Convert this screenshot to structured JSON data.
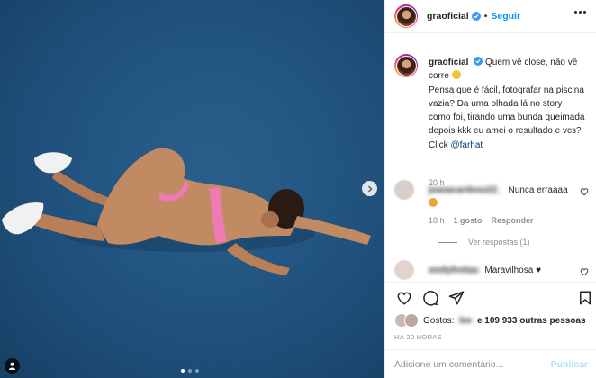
{
  "post": {
    "username": "graoficial",
    "follow_label": "Seguir",
    "caption_username": "graoficial",
    "caption_line1": "Quem vê close, não vê corre",
    "caption_line2": "Pensa que é fácil, fotografar na piscina vazia? Da uma olhada lá no story como foi, tirando uma bunda queimada depois kkk eu amei o resultado e vcs?",
    "caption_click": "Click",
    "caption_mention": "@farhat",
    "caption_time": "20 h"
  },
  "comments": [
    {
      "username": "joanacardoso22_",
      "text": "Nunca erraaaa",
      "time": "18 h",
      "likes": "1 gosto",
      "reply_label": "Responder",
      "view_replies": "Ver respostas (1)"
    },
    {
      "username": "emilyfreitas",
      "text": "Maravilhosa ♥"
    }
  ],
  "likes": {
    "prefix": "Gostos:",
    "blurred_name": "lee",
    "rest": "e 109 933 outras pessoas"
  },
  "post_time": "HÁ 20 HORAS",
  "add_comment": {
    "placeholder": "Adicione um comentário...",
    "publish_label": "Publicar"
  },
  "carousel": {
    "total": 3,
    "active": 0
  },
  "colors": {
    "accent": "#0095f6",
    "verified": "#3897f0",
    "photo_bg": "#1f4f7a"
  }
}
